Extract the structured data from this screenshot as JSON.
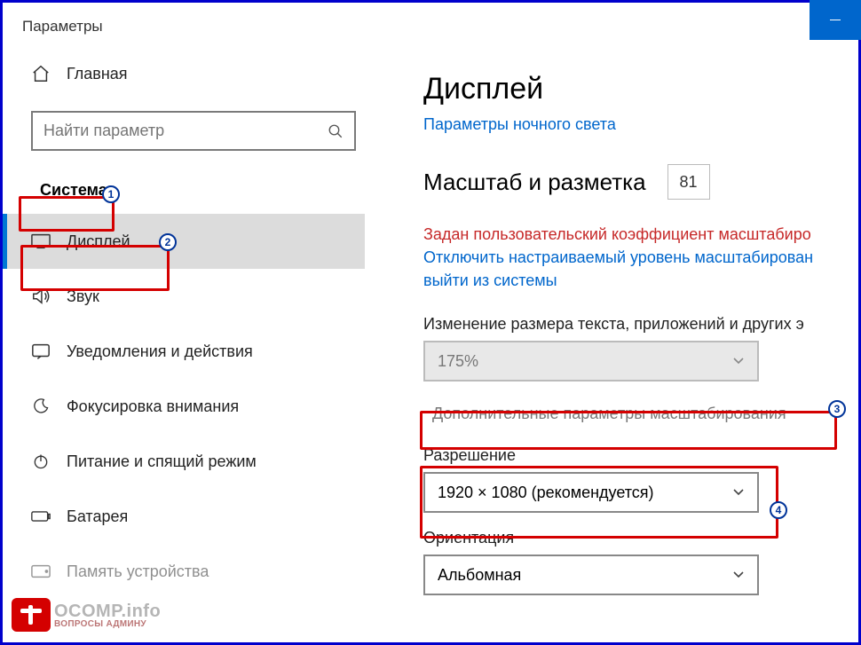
{
  "window": {
    "title": "Параметры"
  },
  "sidebar": {
    "home": "Главная",
    "search_placeholder": "Найти параметр",
    "category": "Система",
    "items": [
      {
        "label": "Дисплей"
      },
      {
        "label": "Звук"
      },
      {
        "label": "Уведомления и действия"
      },
      {
        "label": "Фокусировка внимания"
      },
      {
        "label": "Питание и спящий режим"
      },
      {
        "label": "Батарея"
      },
      {
        "label": "Память устройства"
      }
    ]
  },
  "main": {
    "title": "Дисплей",
    "nightlight_link": "Параметры ночного света",
    "scale_heading": "Масштаб и разметка",
    "scale_badge": "81",
    "warn": "Задан пользовательский коэффициент масштабиро",
    "signout_link": "Отключить настраиваемый уровень масштабирован выйти из системы",
    "resize_label": "Изменение размера текста, приложений и других э",
    "scale_value": "175%",
    "advanced_link": "Дополнительные параметры масштабирования",
    "resolution_label": "Разрешение",
    "resolution_value": "1920 × 1080 (рекомендуется)",
    "orientation_label": "Ориентация",
    "orientation_value": "Альбомная"
  },
  "callouts": {
    "b1": "1",
    "b2": "2",
    "b3": "3",
    "b4": "4"
  },
  "watermark": {
    "main": "OCOMP.info",
    "sub": "ВОПРОСЫ АДМИНУ"
  }
}
